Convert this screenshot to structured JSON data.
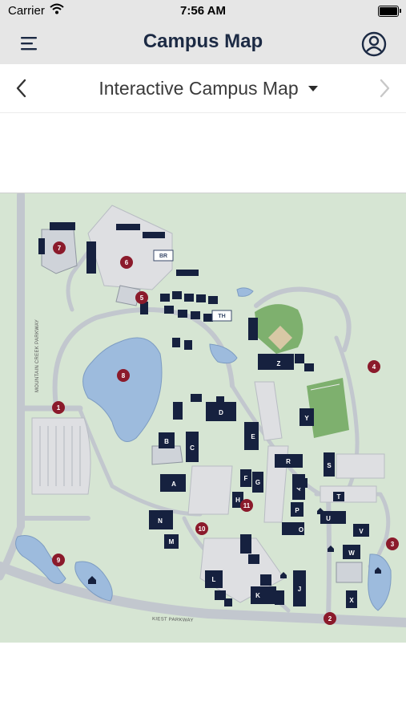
{
  "status_bar": {
    "carrier": "Carrier",
    "time": "7:56 AM"
  },
  "navbar": {
    "title": "Campus Map",
    "menu_icon": "hamburger-menu-icon",
    "profile_icon": "user-circle-icon"
  },
  "map_selector": {
    "selected": "Interactive Campus Map",
    "back_icon": "chevron-left-icon",
    "forward_icon": "chevron-right-icon"
  },
  "map": {
    "road_labels": {
      "west": "MOUNTAIN CREEK PARKWAY",
      "south": "KIEST PARKWAY"
    },
    "signs": {
      "br": "BR",
      "th": "TH"
    },
    "buildings": [
      "A",
      "B",
      "C",
      "D",
      "E",
      "F",
      "G",
      "H",
      "J",
      "K",
      "L",
      "M",
      "N",
      "O",
      "P",
      "Q",
      "R",
      "S",
      "T",
      "U",
      "V",
      "W",
      "X",
      "Y",
      "Z"
    ],
    "markers": [
      "1",
      "2",
      "3",
      "4",
      "5",
      "6",
      "7",
      "8",
      "9",
      "10",
      "11"
    ]
  },
  "colors": {
    "grass": "#d6e5d3",
    "water": "#9dbbdd",
    "road": "#c2c7ce",
    "building": "#16213f",
    "marker": "#8b1a2b",
    "field": "#7eb06e",
    "nav_bg": "#e6e6e6",
    "title": "#1c2a44"
  }
}
